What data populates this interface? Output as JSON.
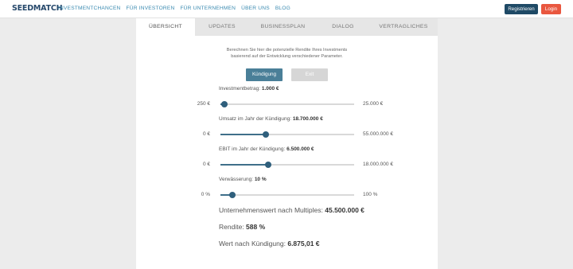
{
  "header": {
    "logo": "SEEDMATCH",
    "nav": [
      "INVESTMENTCHANCEN",
      "FÜR INVESTOREN",
      "FÜR UNTERNEHMEN",
      "ÜBER UNS",
      "BLOG"
    ],
    "register": "Registrieren",
    "login": "Login"
  },
  "tabs": [
    "ÜBERSICHT",
    "UPDATES",
    "BUSINESSPLAN",
    "DIALOG",
    "VERTRAGLICHES"
  ],
  "intro": [
    "Berechnen Sie hier die potenzielle Rendite Ihres Investments",
    "basierend auf der Entwicklung verschiedener Parameter."
  ],
  "buttons": {
    "kuendigung": "Kündigung",
    "exit": "Exit"
  },
  "sliders": [
    {
      "label": "Investmentbetrag:",
      "value": "1.000 €",
      "min": "250 €",
      "max": "25.000 €",
      "fraction": 0.03
    },
    {
      "label": "Umsatz im Jahr der Kündigung:",
      "value": "18.700.000 €",
      "min": "0 €",
      "max": "55.000.000 €",
      "fraction": 0.34
    },
    {
      "label": "EBIT im Jahr der Kündigung:",
      "value": "6.500.000 €",
      "min": "0 €",
      "max": "18.000.000 €",
      "fraction": 0.36
    },
    {
      "label": "Verwässerung:",
      "value": "10 %",
      "min": "0 %",
      "max": "100 %",
      "fraction": 0.09
    }
  ],
  "results": [
    {
      "label": "Unternehmenswert nach Multiples:",
      "value": "45.500.000 €"
    },
    {
      "label": "Rendite:",
      "value": "588 %"
    },
    {
      "label": "Wert nach Kündigung:",
      "value": "6.875,01 €"
    }
  ],
  "colors": {
    "primary": "#1f4a66",
    "accent": "#e9573f",
    "slider": "#2f5f7c"
  }
}
